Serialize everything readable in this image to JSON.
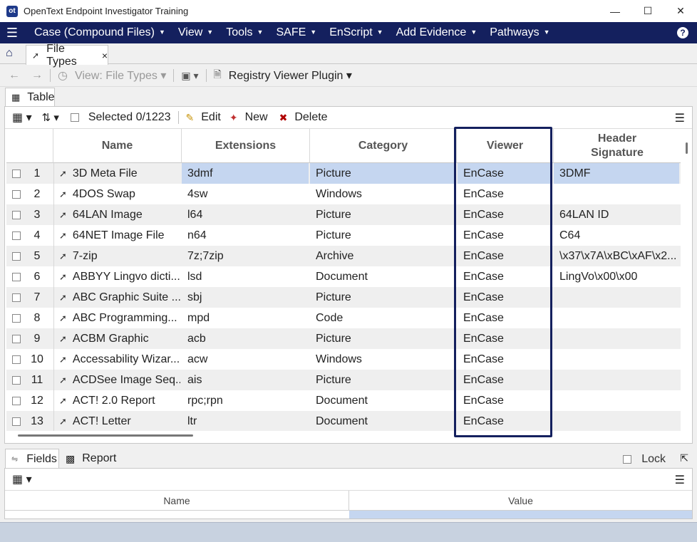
{
  "window": {
    "title": "OpenText Endpoint Investigator Training",
    "logo": "ot"
  },
  "menubar": {
    "items": [
      "Case (Compound Files)",
      "View",
      "Tools",
      "SAFE",
      "EnScript",
      "Add Evidence",
      "Pathways"
    ]
  },
  "tabs": {
    "doc_tab": "File Types",
    "close": "×"
  },
  "toolbar1": {
    "view_label": "View: File Types",
    "plugin_label": "Registry Viewer Plugin"
  },
  "table_pane": {
    "tab_label": "Table"
  },
  "toolbar2": {
    "selected": "Selected 0/1223",
    "edit": "Edit",
    "new": "New",
    "delete": "Delete"
  },
  "columns": [
    "Name",
    "Extensions",
    "Category",
    "Viewer",
    "Header Signature"
  ],
  "rows": [
    {
      "n": "1",
      "name": "3D Meta File",
      "ext": "3dmf",
      "cat": "Picture",
      "viewer": "EnCase",
      "sig": "3DMF"
    },
    {
      "n": "2",
      "name": "4DOS Swap",
      "ext": "4sw",
      "cat": "Windows",
      "viewer": "EnCase",
      "sig": ""
    },
    {
      "n": "3",
      "name": "64LAN Image",
      "ext": "l64",
      "cat": "Picture",
      "viewer": "EnCase",
      "sig": "64LAN ID"
    },
    {
      "n": "4",
      "name": "64NET Image File",
      "ext": "n64",
      "cat": "Picture",
      "viewer": "EnCase",
      "sig": "C64"
    },
    {
      "n": "5",
      "name": "7-zip",
      "ext": "7z;7zip",
      "cat": "Archive",
      "viewer": "EnCase",
      "sig": "\\x37\\x7A\\xBC\\xAF\\x2..."
    },
    {
      "n": "6",
      "name": "ABBYY Lingvo dicti...",
      "ext": "lsd",
      "cat": "Document",
      "viewer": "EnCase",
      "sig": "LingVo\\x00\\x00"
    },
    {
      "n": "7",
      "name": "ABC Graphic Suite ...",
      "ext": "sbj",
      "cat": "Picture",
      "viewer": "EnCase",
      "sig": ""
    },
    {
      "n": "8",
      "name": "ABC Programming...",
      "ext": "mpd",
      "cat": "Code",
      "viewer": "EnCase",
      "sig": ""
    },
    {
      "n": "9",
      "name": "ACBM Graphic",
      "ext": "acb",
      "cat": "Picture",
      "viewer": "EnCase",
      "sig": ""
    },
    {
      "n": "10",
      "name": "Accessability Wizar...",
      "ext": "acw",
      "cat": "Windows",
      "viewer": "EnCase",
      "sig": ""
    },
    {
      "n": "11",
      "name": "ACDSee Image Seq...",
      "ext": "ais",
      "cat": "Picture",
      "viewer": "EnCase",
      "sig": ""
    },
    {
      "n": "12",
      "name": "ACT! 2.0 Report",
      "ext": "rpc;rpn",
      "cat": "Document",
      "viewer": "EnCase",
      "sig": ""
    },
    {
      "n": "13",
      "name": "ACT! Letter",
      "ext": "ltr",
      "cat": "Document",
      "viewer": "EnCase",
      "sig": ""
    }
  ],
  "bottom": {
    "fields_tab": "Fields",
    "report_tab": "Report",
    "lock_label": "Lock",
    "col_name": "Name",
    "col_value": "Value"
  },
  "colors": {
    "menubar": "#14205e",
    "selection": "#c5d6f0",
    "highlight_box": "#14205e"
  }
}
